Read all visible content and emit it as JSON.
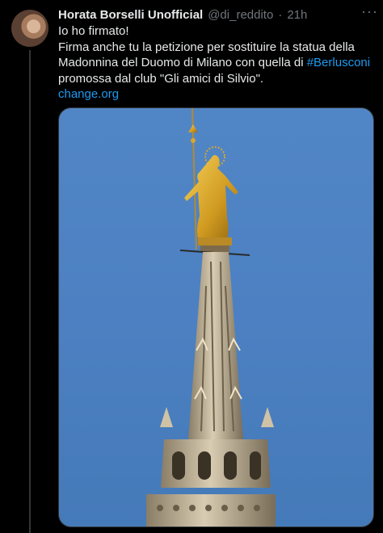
{
  "tweet": {
    "author_name": "Horata Borselli Unofficial",
    "handle": "@di_reddito",
    "separator": "·",
    "time": "21h",
    "more_icon": "more-horizontal-icon",
    "line1": "Io ho firmato!",
    "line2_before": "Firma anche tu la petizione per sostituire la statua della Madonnina del Duomo di Milano con quella di ",
    "hashtag": "#Berlusconi",
    "line2_after": "promossa dal club \"Gli amici di Silvio\".",
    "link": "change.org"
  },
  "colors": {
    "background": "#000000",
    "text": "#e7e9ea",
    "muted": "#71767b",
    "accent": "#1d9bf0",
    "sky": "#4c80c2",
    "gold": "#d9a72a"
  }
}
